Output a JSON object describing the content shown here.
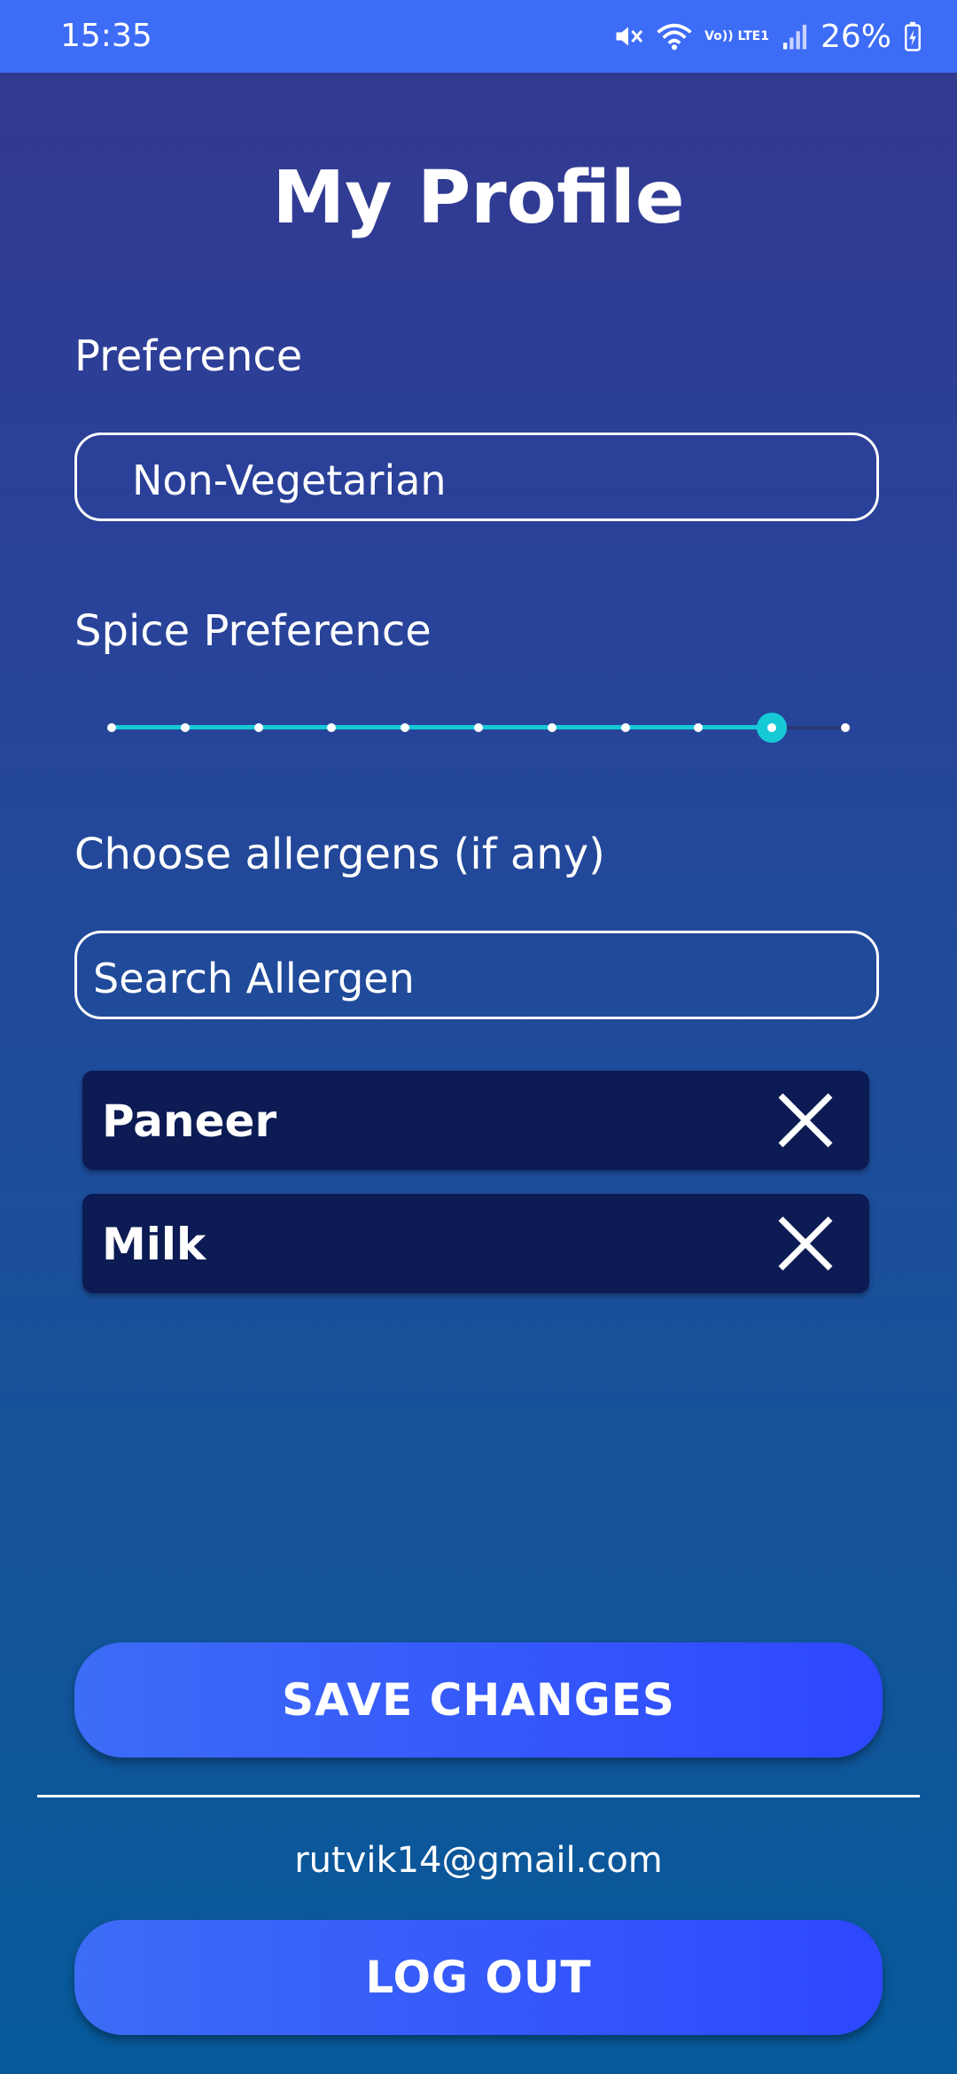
{
  "status_bar": {
    "time": "15:35",
    "battery": "26%",
    "network_label": "Vo)) LTE1",
    "icons": [
      "mute-icon",
      "wifi-icon",
      "volte-icon",
      "signal-icon",
      "battery-charging-icon"
    ]
  },
  "page": {
    "title": "My Profile"
  },
  "preference": {
    "label": "Preference",
    "value": "Non-Vegetarian"
  },
  "spice": {
    "label": "Spice Preference",
    "steps": 11,
    "value": 9,
    "max": 10,
    "accent": "#16c9d6"
  },
  "allergens": {
    "label": "Choose allergens (if any)",
    "search_placeholder": "Search Allergen",
    "selected": [
      {
        "name": "Paneer"
      },
      {
        "name": "Milk"
      }
    ]
  },
  "actions": {
    "save_label": "SAVE CHANGES",
    "logout_label": "LOG OUT"
  },
  "account": {
    "email": "rutvik14@gmail.com"
  },
  "colors": {
    "status_bar": "#3d6cf6",
    "chip_bg": "#0c1b53",
    "button": "#3d6cf6"
  }
}
